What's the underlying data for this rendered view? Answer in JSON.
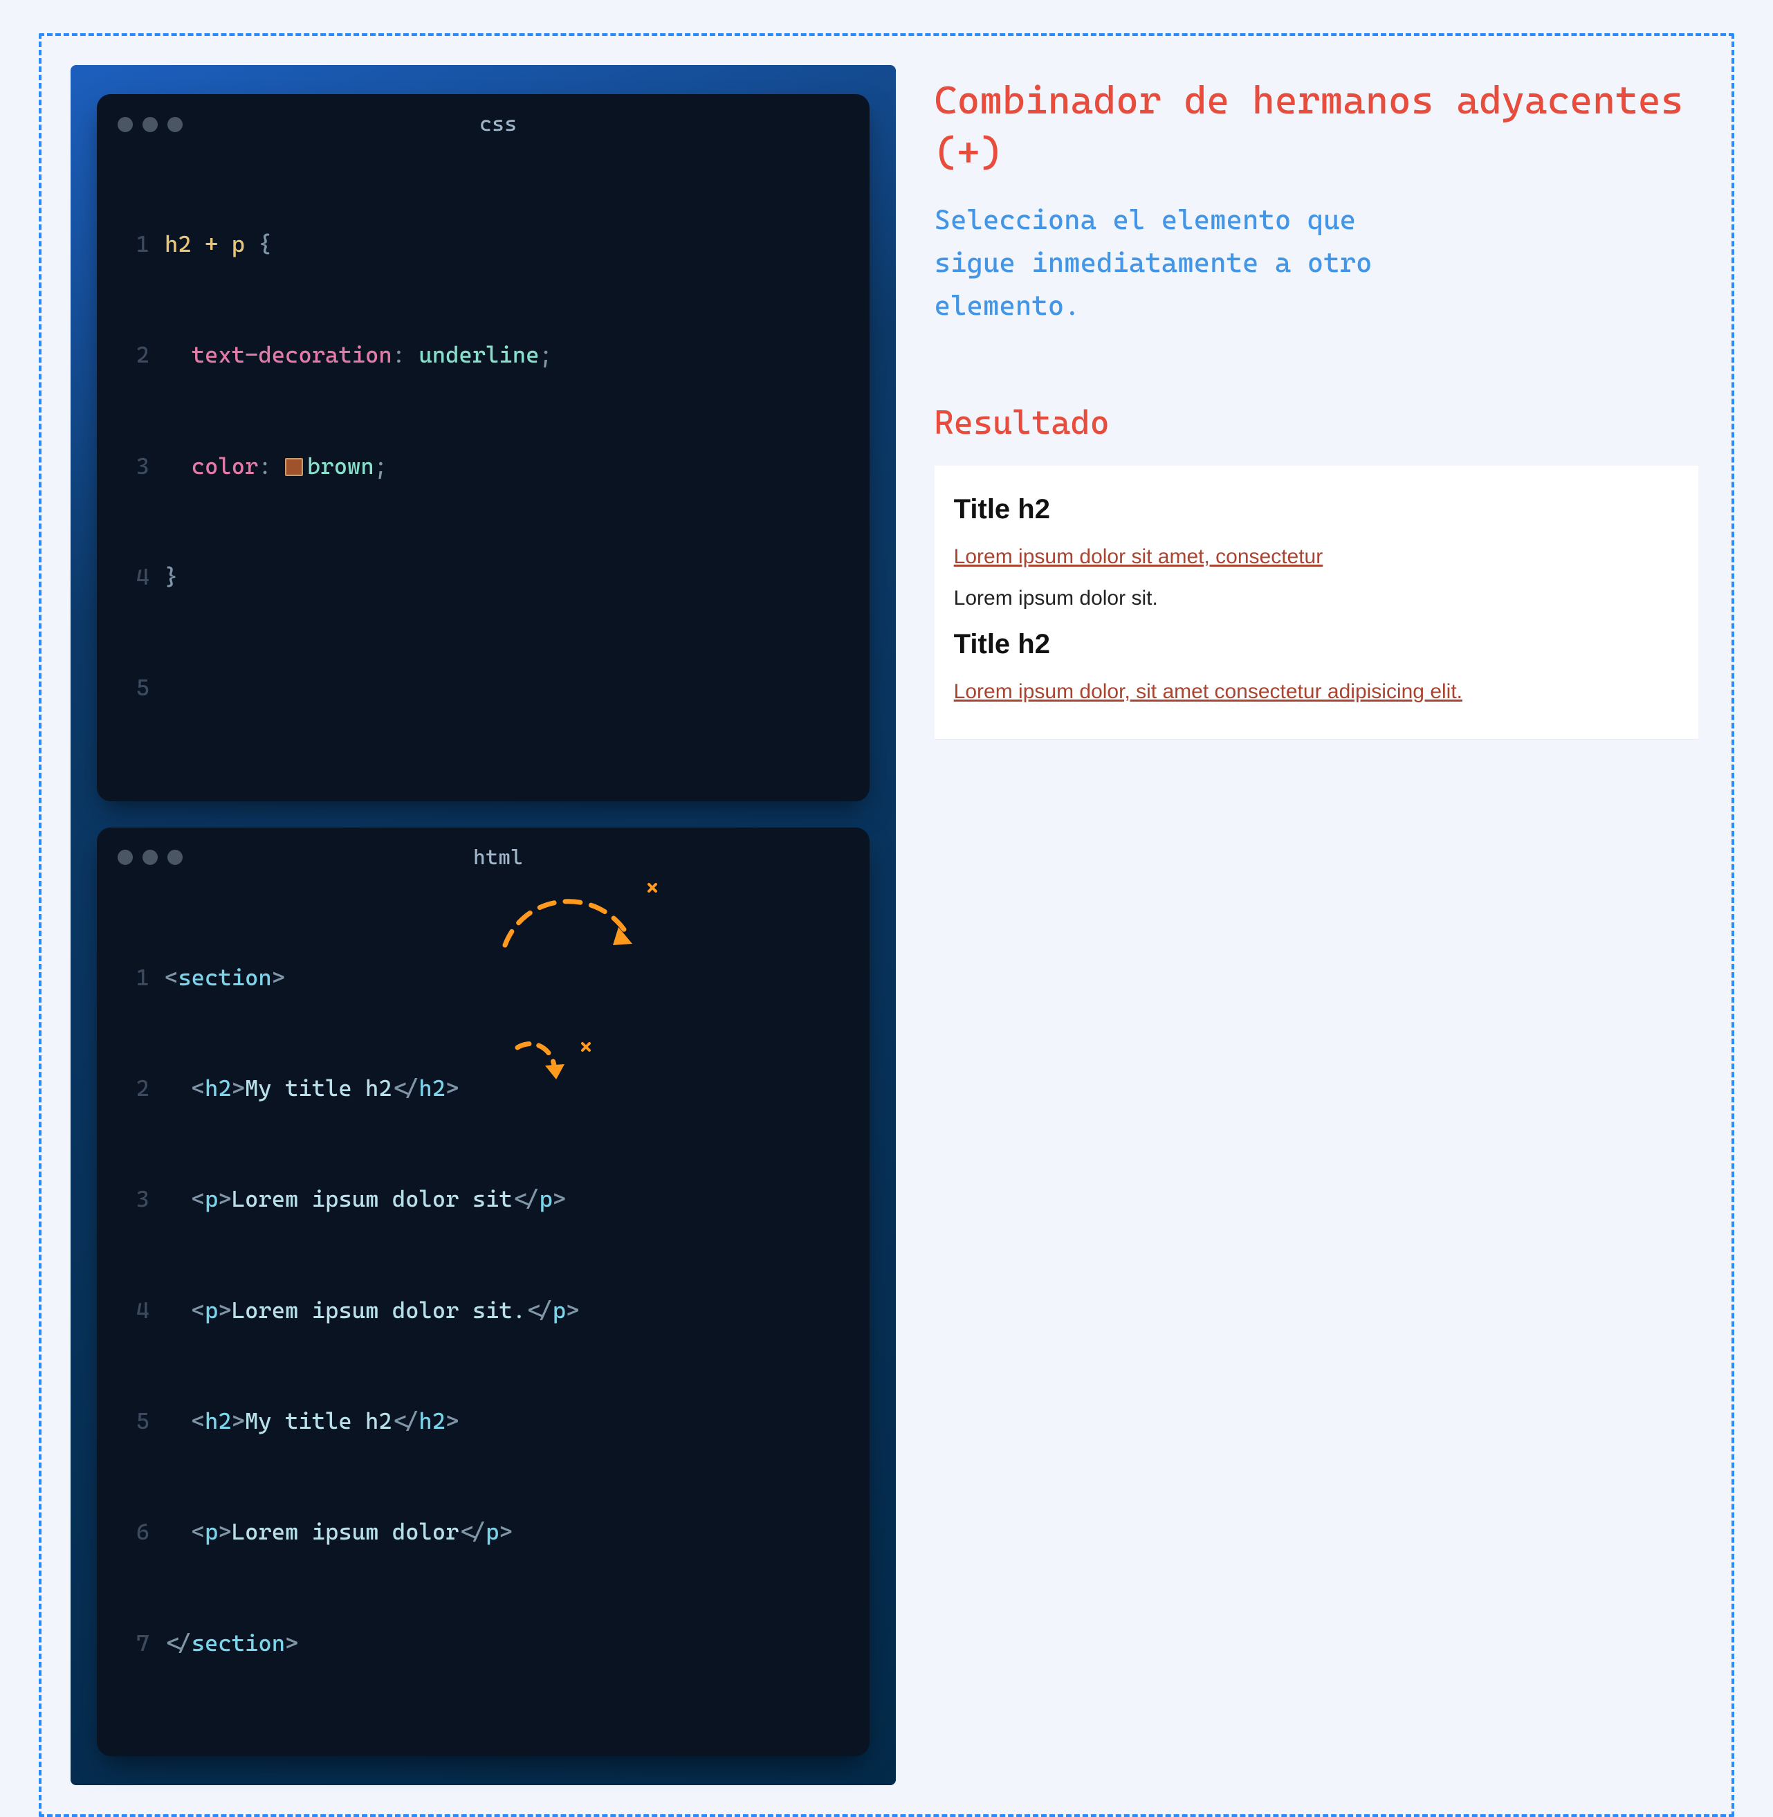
{
  "heading": "Combinador de hermanos adyacentes (+)",
  "description": "Selecciona el elemento que sigue inmediatamente a otro elemento.",
  "result_label": "Resultado",
  "css_editor": {
    "title": "css",
    "lines": {
      "1": {
        "n": "1",
        "selector": "h2 + p",
        "open": " {"
      },
      "2": {
        "n": "2",
        "indent": "  ",
        "prop": "text-decoration",
        "colon": ": ",
        "val": "underline",
        "semi": ";"
      },
      "3": {
        "n": "3",
        "indent": "  ",
        "prop": "color",
        "colon": ": ",
        "val": "brown",
        "semi": ";"
      },
      "4": {
        "n": "4",
        "close": "}"
      },
      "5": {
        "n": "5"
      }
    }
  },
  "html_editor": {
    "title": "html",
    "lines": {
      "1": {
        "n": "1",
        "open": "<",
        "tag": "section",
        "close": ">"
      },
      "2": {
        "n": "2",
        "indent": "  ",
        "open": "<",
        "tag": "h2",
        "gt": ">",
        "text": "My title h2",
        "copen": "</",
        "ctag": "h2",
        "cgt": ">"
      },
      "3": {
        "n": "3",
        "indent": "  ",
        "open": "<",
        "tag": "p",
        "gt": ">",
        "text": "Lorem ipsum dolor sit",
        "copen": "</",
        "ctag": "p",
        "cgt": ">"
      },
      "4": {
        "n": "4",
        "indent": "  ",
        "open": "<",
        "tag": "p",
        "gt": ">",
        "text": "Lorem ipsum dolor sit.",
        "copen": "</",
        "ctag": "p",
        "cgt": ">"
      },
      "5": {
        "n": "5",
        "indent": "  ",
        "open": "<",
        "tag": "h2",
        "gt": ">",
        "text": "My title h2",
        "copen": "</",
        "ctag": "h2",
        "cgt": ">"
      },
      "6": {
        "n": "6",
        "indent": "  ",
        "open": "<",
        "tag": "p",
        "gt": ">",
        "text": "Lorem ipsum dolor",
        "copen": "</",
        "ctag": "p",
        "cgt": ">"
      },
      "7": {
        "n": "7",
        "open": "</",
        "tag": "section",
        "close": ">"
      }
    }
  },
  "result": {
    "h2a": "Title h2",
    "p1": "Lorem ipsum dolor sit amet, consectetur",
    "p2": "Lorem ipsum dolor sit.",
    "h2b": "Title h2",
    "p3": "Lorem ipsum dolor, sit amet consectetur adipisicing elit."
  }
}
